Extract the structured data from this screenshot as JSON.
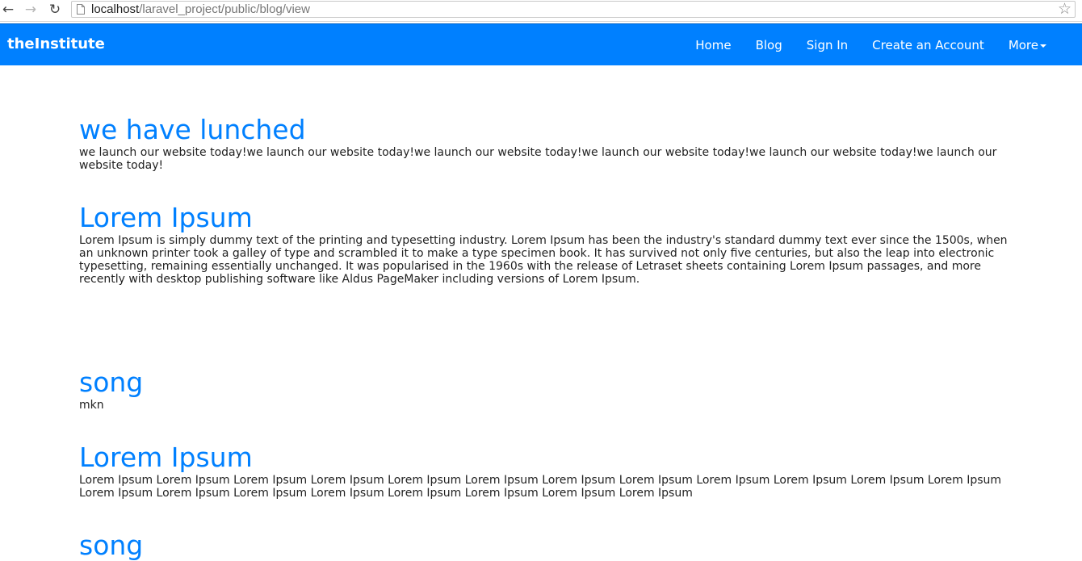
{
  "browser": {
    "url_host": "localhost",
    "url_path": "/laravel_project/public/blog/view"
  },
  "navbar": {
    "brand": "theInstitute",
    "items": [
      {
        "label": "Home"
      },
      {
        "label": "Blog"
      },
      {
        "label": "Sign In"
      },
      {
        "label": "Create an Account"
      },
      {
        "label": "More"
      }
    ]
  },
  "posts": [
    {
      "title": "we have lunched",
      "body": "we launch our website today!we launch our website today!we launch our website today!we launch our website today!we launch our website today!we launch our website today!"
    },
    {
      "title": "Lorem Ipsum",
      "body": "Lorem Ipsum is simply dummy text of the printing and typesetting industry. Lorem Ipsum has been the industry's standard dummy text ever since the 1500s, when an unknown printer took a galley of type and scrambled it to make a type specimen book. It has survived not only five centuries, but also the leap into electronic typesetting, remaining essentially unchanged. It was popularised in the 1960s with the release of Letraset sheets containing Lorem Ipsum passages, and more recently with desktop publishing software like Aldus PageMaker including versions of Lorem Ipsum."
    },
    {
      "title": "song",
      "body": "mkn"
    },
    {
      "title": "Lorem Ipsum",
      "body": "Lorem Ipsum Lorem Ipsum Lorem Ipsum Lorem Ipsum Lorem Ipsum Lorem Ipsum Lorem Ipsum Lorem Ipsum Lorem Ipsum Lorem Ipsum Lorem Ipsum Lorem Ipsum Lorem Ipsum Lorem Ipsum Lorem Ipsum Lorem Ipsum Lorem Ipsum Lorem Ipsum Lorem Ipsum Lorem Ipsum"
    },
    {
      "title": "song",
      "body": ""
    }
  ],
  "colors": {
    "navbar_bg": "#0080ff",
    "heading": "#0080ff",
    "text": "#222222"
  }
}
